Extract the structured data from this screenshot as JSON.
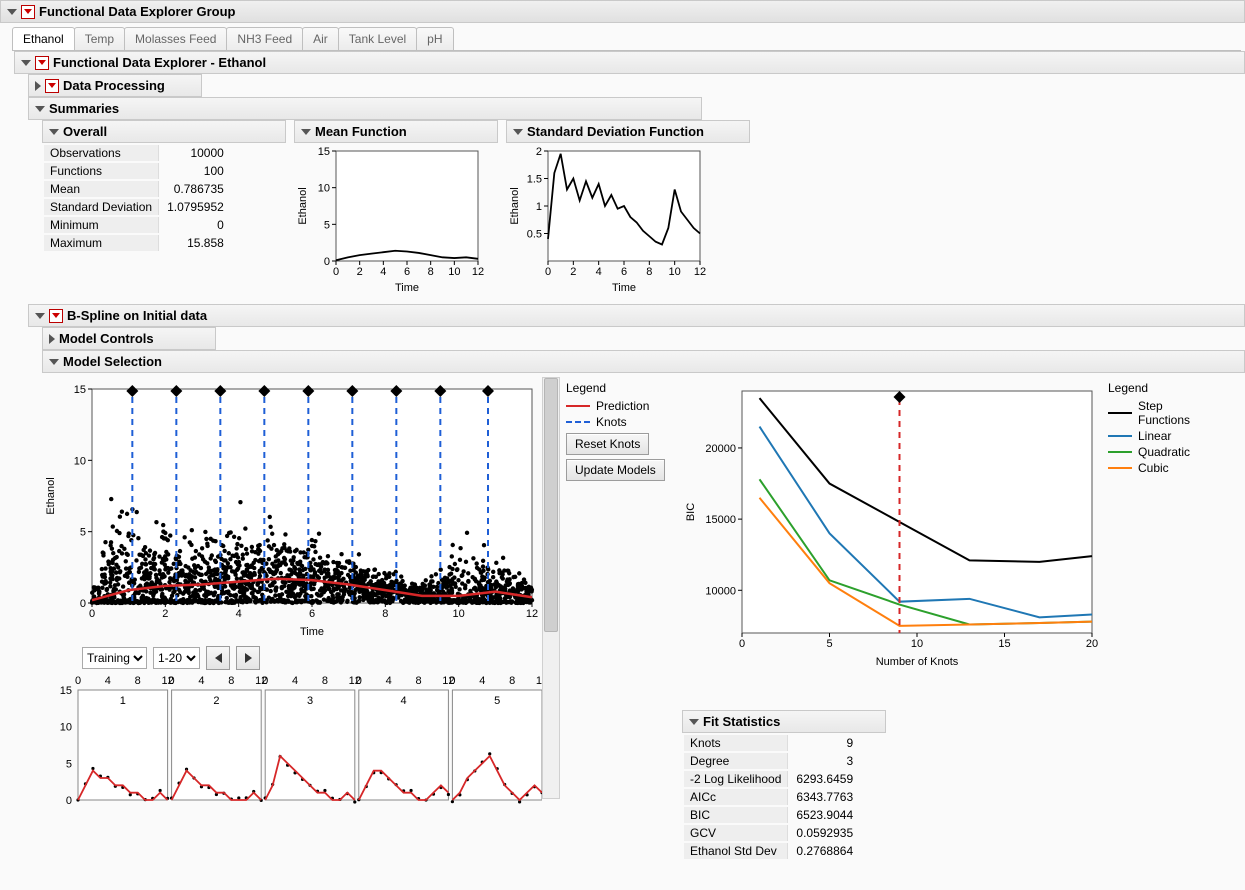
{
  "main_title": "Functional Data Explorer Group",
  "tabs": [
    "Ethanol",
    "Temp",
    "Molasses Feed",
    "NH3 Feed",
    "Air",
    "Tank Level",
    "pH"
  ],
  "active_tab": 0,
  "sub_title": "Functional Data Explorer - Ethanol",
  "sections": {
    "data_processing": "Data Processing",
    "summaries": "Summaries",
    "overall": "Overall",
    "mean_fn": "Mean Function",
    "sd_fn": "Standard Deviation Function",
    "bspline": "B-Spline on Initial data",
    "model_controls": "Model Controls",
    "model_selection": "Model Selection",
    "fit_stats": "Fit Statistics"
  },
  "overall_stats": [
    {
      "label": "Observations",
      "value": "10000"
    },
    {
      "label": "Functions",
      "value": "100"
    },
    {
      "label": "Mean",
      "value": "0.786735"
    },
    {
      "label": "Standard Deviation",
      "value": "1.0795952"
    },
    {
      "label": "Minimum",
      "value": "0"
    },
    {
      "label": "Maximum",
      "value": "15.858"
    }
  ],
  "fit_stats": [
    {
      "label": "Knots",
      "value": "9"
    },
    {
      "label": "Degree",
      "value": "3"
    },
    {
      "label": "-2 Log Likelihood",
      "value": "6293.6459"
    },
    {
      "label": "AICc",
      "value": "6343.7763"
    },
    {
      "label": "BIC",
      "value": "6523.9044"
    },
    {
      "label": "GCV",
      "value": "0.0592935"
    },
    {
      "label": "Ethanol Std Dev",
      "value": "0.2768864"
    }
  ],
  "legend1": {
    "title": "Legend",
    "items": [
      {
        "name": "Prediction",
        "color": "#d62728",
        "dash": false
      },
      {
        "name": "Knots",
        "color": "#1f5fd6",
        "dash": true
      }
    ]
  },
  "legend2": {
    "title": "Legend",
    "items": [
      {
        "name": "Step Functions",
        "color": "#000000"
      },
      {
        "name": "Linear",
        "color": "#1f77b4"
      },
      {
        "name": "Quadratic",
        "color": "#2ca02c"
      },
      {
        "name": "Cubic",
        "color": "#ff7f0e"
      }
    ]
  },
  "buttons": {
    "reset_knots": "Reset Knots",
    "update_models": "Update Models"
  },
  "selectors": {
    "subset": "Training",
    "range": "1-20"
  },
  "axis_labels": {
    "time": "Time",
    "ethanol": "Ethanol",
    "bic": "BIC",
    "knots": "Number of Knots"
  },
  "chart_data": [
    {
      "type": "line",
      "name": "mean_function",
      "xlabel": "Time",
      "ylabel": "Ethanol",
      "x": [
        0,
        1,
        2,
        3,
        4,
        5,
        6,
        7,
        8,
        9,
        10,
        11,
        12
      ],
      "values": [
        0.1,
        0.5,
        0.8,
        1.0,
        1.2,
        1.4,
        1.3,
        1.1,
        0.8,
        0.5,
        0.4,
        0.5,
        0.3
      ],
      "xlim": [
        0,
        12
      ],
      "ylim": [
        0,
        15
      ],
      "xticks": [
        0,
        2,
        4,
        6,
        8,
        10,
        12
      ],
      "yticks": [
        0,
        5,
        10,
        15
      ]
    },
    {
      "type": "line",
      "name": "sd_function",
      "xlabel": "Time",
      "ylabel": "Ethanol",
      "x": [
        0,
        0.5,
        1,
        1.5,
        2,
        2.5,
        3,
        3.5,
        4,
        4.5,
        5,
        5.5,
        6,
        6.5,
        7,
        7.5,
        8,
        8.5,
        9,
        9.5,
        10,
        10.5,
        11,
        11.5,
        12
      ],
      "values": [
        0.4,
        1.6,
        1.95,
        1.3,
        1.5,
        1.1,
        1.45,
        1.15,
        1.4,
        1.0,
        1.2,
        0.95,
        1.0,
        0.8,
        0.7,
        0.55,
        0.45,
        0.35,
        0.3,
        0.6,
        1.3,
        0.9,
        0.75,
        0.6,
        0.5
      ],
      "xlim": [
        0,
        12
      ],
      "ylim": [
        0,
        2.0
      ],
      "xticks": [
        0,
        2,
        4,
        6,
        8,
        10,
        12
      ],
      "yticks": [
        0.5,
        1.0,
        1.5,
        2.0
      ]
    },
    {
      "type": "scatter_with_line",
      "name": "model_selection_main",
      "xlabel": "Time",
      "ylabel": "Ethanol",
      "xlim": [
        0,
        12
      ],
      "ylim": [
        0,
        15
      ],
      "xticks": [
        0,
        2,
        4,
        6,
        8,
        10,
        12
      ],
      "yticks": [
        0,
        5,
        10,
        15
      ],
      "knots": [
        1.1,
        2.3,
        3.5,
        4.7,
        5.9,
        7.1,
        8.3,
        9.5,
        10.8
      ],
      "prediction": {
        "x": [
          0,
          1,
          2,
          3,
          4,
          5,
          6,
          7,
          8,
          9,
          10,
          11,
          12
        ],
        "y": [
          0.2,
          0.9,
          1.2,
          1.3,
          1.5,
          1.7,
          1.6,
          1.3,
          0.9,
          0.5,
          0.5,
          0.8,
          0.4
        ]
      }
    },
    {
      "type": "line",
      "name": "bic_vs_knots",
      "xlabel": "Number of Knots",
      "ylabel": "BIC",
      "x": [
        1,
        5,
        9,
        13,
        17,
        20
      ],
      "series": [
        {
          "name": "Step Functions",
          "color": "#000",
          "values": [
            23500,
            17500,
            14800,
            12100,
            12000,
            12400
          ]
        },
        {
          "name": "Linear",
          "color": "#1f77b4",
          "values": [
            21500,
            14000,
            9200,
            9400,
            8100,
            8300
          ]
        },
        {
          "name": "Quadratic",
          "color": "#2ca02c",
          "values": [
            17800,
            10700,
            9000,
            7600,
            7700,
            7800
          ]
        },
        {
          "name": "Cubic",
          "color": "#ff7f0e",
          "values": [
            16500,
            10500,
            7500,
            7600,
            7700,
            7800
          ]
        }
      ],
      "selected_knots": 9,
      "xlim": [
        0,
        20
      ],
      "ylim": [
        7000,
        24000
      ],
      "xticks": [
        0,
        5,
        10,
        15,
        20
      ],
      "yticks": [
        10000,
        15000,
        20000
      ]
    },
    {
      "type": "small_multiples",
      "name": "training_panels",
      "count": 5,
      "xlim": [
        0,
        12
      ],
      "ylim": [
        0,
        15
      ],
      "xticks": [
        0,
        4,
        8,
        12
      ],
      "yticks": [
        0,
        5,
        10,
        15
      ],
      "panels": [
        {
          "id": "1",
          "y": [
            0,
            2,
            4,
            3,
            3,
            2,
            2,
            1,
            1,
            0,
            0,
            1,
            0
          ]
        },
        {
          "id": "2",
          "y": [
            0,
            2,
            4,
            3,
            2,
            2,
            1,
            1,
            0,
            0,
            0,
            1,
            0
          ]
        },
        {
          "id": "3",
          "y": [
            0,
            2,
            6,
            5,
            4,
            3,
            2,
            1,
            1,
            0,
            0,
            1,
            0
          ]
        },
        {
          "id": "4",
          "y": [
            0,
            2,
            4,
            4,
            3,
            2,
            1,
            1,
            0,
            0,
            1,
            2,
            1
          ]
        },
        {
          "id": "5",
          "y": [
            0,
            1,
            3,
            4,
            5,
            6,
            4,
            2,
            1,
            0,
            1,
            2,
            1
          ]
        }
      ]
    }
  ]
}
